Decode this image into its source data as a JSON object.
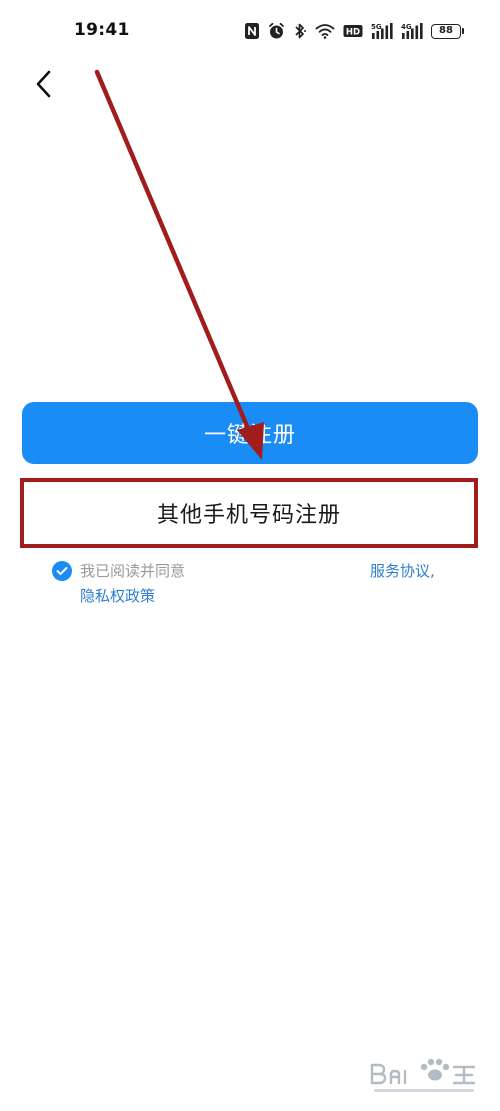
{
  "status_bar": {
    "time": "19:41",
    "battery": "88",
    "icons": [
      "nfc-icon",
      "alarm-icon",
      "bluetooth-icon",
      "wifi-icon",
      "hd-icon",
      "signal-5g-icon",
      "signal-4g-icon",
      "battery-icon"
    ],
    "signal_5g_label": "5G",
    "signal_4g_label": "4G",
    "hd_label": "HD"
  },
  "nav": {
    "back_icon": "chevron-left-icon"
  },
  "buttons": {
    "one_click_register": "一键注册",
    "other_phone_register": "其他手机号码注册"
  },
  "agreement": {
    "prefix": "我已阅读并同意",
    "service_agreement": "服务协议,",
    "privacy_policy": "隐私权政策"
  },
  "colors": {
    "primary": "#1a8cf5",
    "link": "#2f7fd0",
    "annotation": "#a11d1d"
  }
}
